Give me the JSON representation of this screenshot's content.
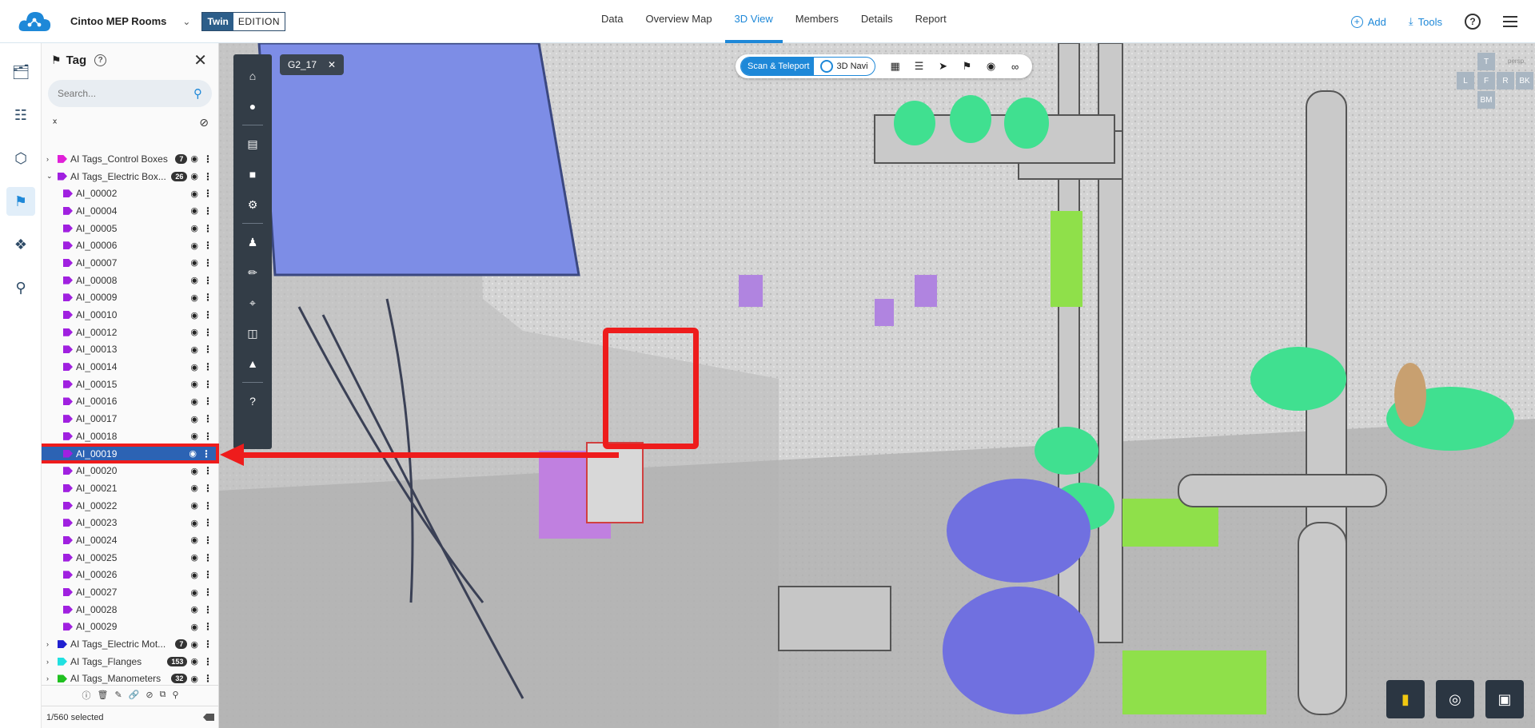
{
  "header": {
    "project_name": "Cintoo MEP Rooms",
    "edition_twin": "Twin",
    "edition_label": "EDITION",
    "tabs": [
      {
        "label": "Data"
      },
      {
        "label": "Overview Map"
      },
      {
        "label": "3D View"
      },
      {
        "label": "Members"
      },
      {
        "label": "Details"
      },
      {
        "label": "Report"
      }
    ],
    "active_tab": "3D View",
    "add_label": "Add",
    "tools_label": "Tools"
  },
  "panel": {
    "title": "Tag",
    "search_placeholder": "Search...",
    "status": "1/560 selected",
    "groups_top": [
      {
        "label": "AI Tags_Control Boxes",
        "count": "7",
        "color": "#e020d8",
        "expanded": false
      },
      {
        "label": "AI Tags_Electric Box...",
        "count": "26",
        "color": "#a020e0",
        "expanded": true
      }
    ],
    "children": [
      {
        "label": "AI_00002"
      },
      {
        "label": "AI_00004"
      },
      {
        "label": "AI_00005"
      },
      {
        "label": "AI_00006"
      },
      {
        "label": "AI_00007"
      },
      {
        "label": "AI_00008"
      },
      {
        "label": "AI_00009"
      },
      {
        "label": "AI_00010"
      },
      {
        "label": "AI_00012"
      },
      {
        "label": "AI_00013"
      },
      {
        "label": "AI_00014"
      },
      {
        "label": "AI_00015"
      },
      {
        "label": "AI_00016"
      },
      {
        "label": "AI_00017"
      },
      {
        "label": "AI_00018"
      },
      {
        "label": "AI_00019",
        "selected": true
      },
      {
        "label": "AI_00020"
      },
      {
        "label": "AI_00021"
      },
      {
        "label": "AI_00022"
      },
      {
        "label": "AI_00023"
      },
      {
        "label": "AI_00024"
      },
      {
        "label": "AI_00025"
      },
      {
        "label": "AI_00026"
      },
      {
        "label": "AI_00027"
      },
      {
        "label": "AI_00028"
      },
      {
        "label": "AI_00029"
      }
    ],
    "child_color": "#a020e0",
    "groups_bottom": [
      {
        "label": "AI Tags_Electric Mot...",
        "count": "7",
        "color": "#2020d0"
      },
      {
        "label": "AI Tags_Flanges",
        "count": "153",
        "color": "#20e0e0"
      },
      {
        "label": "AI Tags_Manometers",
        "count": "32",
        "color": "#20c020"
      }
    ]
  },
  "viewport": {
    "scan_chip": "G2_17",
    "mode_scan": "Scan & Teleport",
    "mode_navi": "3D Navi",
    "cube": {
      "top": "T",
      "persp": "persp.",
      "left": "L",
      "front": "F",
      "right": "R",
      "back": "BK",
      "bottom": "BM"
    }
  },
  "colors": {
    "accent": "#1e88d8",
    "selected_row": "#2c63b4",
    "annotation": "#ee1c1c",
    "toolbar_dark": "#333d47"
  }
}
